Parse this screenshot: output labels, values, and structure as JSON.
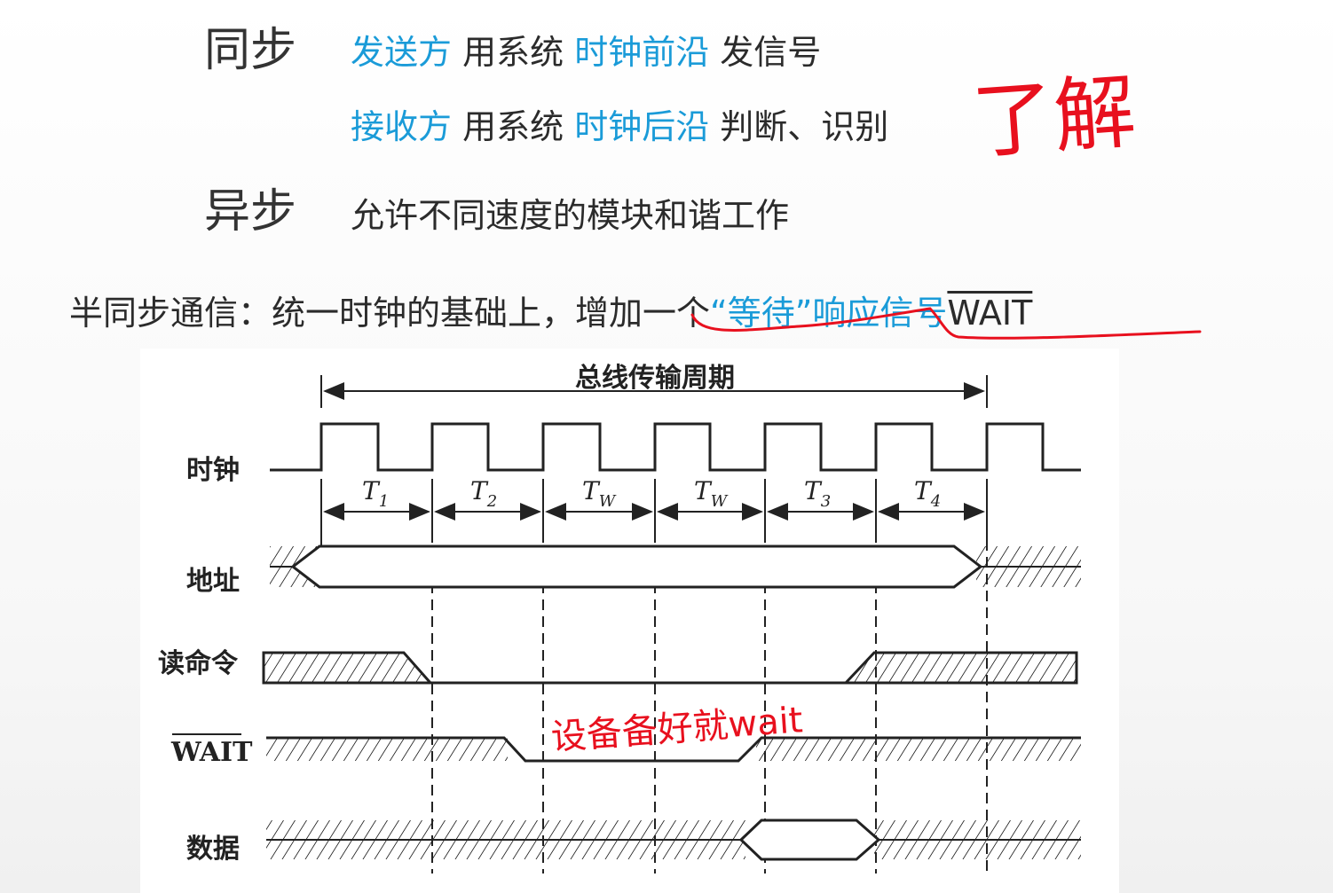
{
  "sync": {
    "heading": "同步",
    "row1": {
      "p1": "发送方",
      "p2": " 用系统 ",
      "p3": "时钟前沿",
      "p4": " 发信号"
    },
    "row2": {
      "p1": "接收方",
      "p2": " 用系统 ",
      "p3": "时钟后沿",
      "p4": " 判断、识别"
    }
  },
  "async": {
    "heading": "异步",
    "desc": "允许不同速度的模块和谐工作"
  },
  "semi": {
    "p1": "半同步通信：统一时钟的基础上，增加一个",
    "p2": "“等待”响应信号",
    "p3": "WAIT"
  },
  "annotations": {
    "margin_note": "了解",
    "device_note": "设备备好就wait"
  },
  "diagram": {
    "title": "总线传输周期",
    "signals": [
      "时钟",
      "地址",
      "读命令",
      "WAIT",
      "数据"
    ],
    "periods": [
      {
        "t": "T",
        "sub": "1"
      },
      {
        "t": "T",
        "sub": "2"
      },
      {
        "t": "T",
        "sub": "W"
      },
      {
        "t": "T",
        "sub": "W"
      },
      {
        "t": "T",
        "sub": "3"
      },
      {
        "t": "T",
        "sub": "4"
      }
    ]
  },
  "colors": {
    "accent": "#1a9bd8",
    "handwriting": "#e8101e",
    "ink": "#222222"
  }
}
